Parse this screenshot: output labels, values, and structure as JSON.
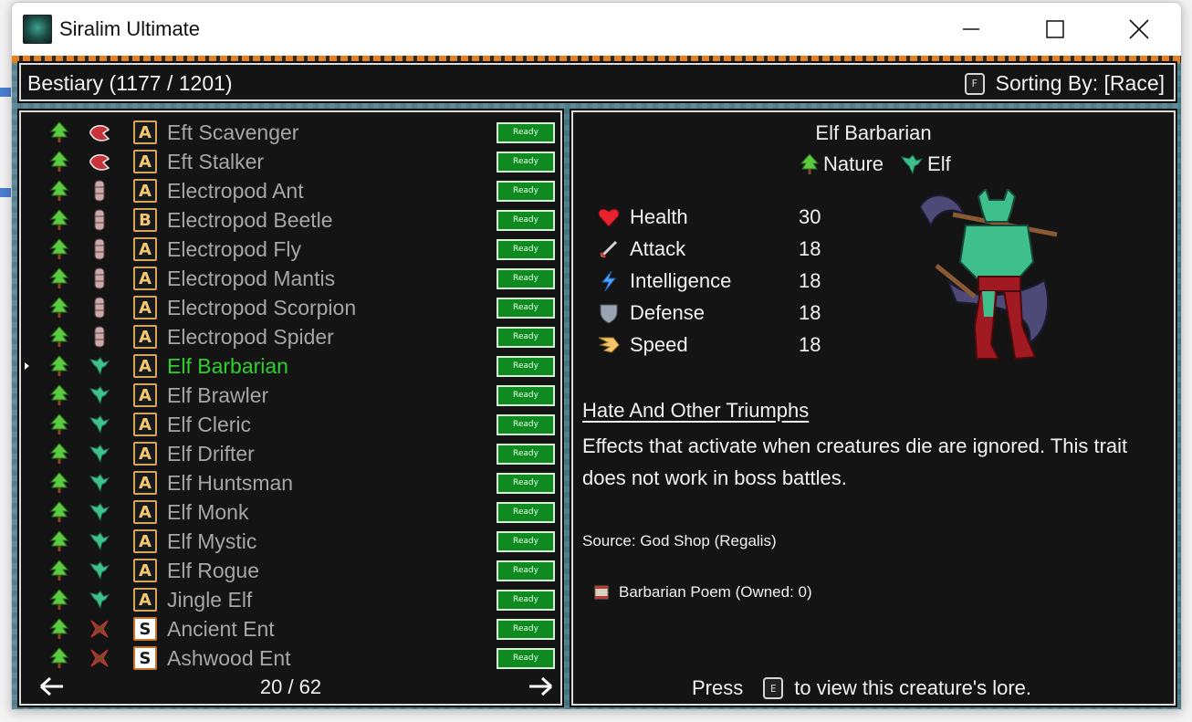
{
  "window": {
    "title": "Siralim Ultimate"
  },
  "header": {
    "title": "Bestiary (1177 / 1201)",
    "sort_key": "F",
    "sort_label": "Sorting By: [Race]"
  },
  "list": {
    "rows": [
      {
        "name": "Eft Scavenger",
        "race": "eft",
        "rarity": "A",
        "status": "Ready"
      },
      {
        "name": "Eft Stalker",
        "race": "eft",
        "rarity": "A",
        "status": "Ready"
      },
      {
        "name": "Electropod Ant",
        "race": "electropod",
        "rarity": "A",
        "status": "Ready"
      },
      {
        "name": "Electropod Beetle",
        "race": "electropod",
        "rarity": "B",
        "status": "Ready"
      },
      {
        "name": "Electropod Fly",
        "race": "electropod",
        "rarity": "A",
        "status": "Ready"
      },
      {
        "name": "Electropod Mantis",
        "race": "electropod",
        "rarity": "A",
        "status": "Ready"
      },
      {
        "name": "Electropod Scorpion",
        "race": "electropod",
        "rarity": "A",
        "status": "Ready"
      },
      {
        "name": "Electropod Spider",
        "race": "electropod",
        "rarity": "A",
        "status": "Ready"
      },
      {
        "name": "Elf Barbarian",
        "race": "elf",
        "rarity": "A",
        "status": "Ready",
        "selected": true
      },
      {
        "name": "Elf Brawler",
        "race": "elf",
        "rarity": "A",
        "status": "Ready"
      },
      {
        "name": "Elf Cleric",
        "race": "elf",
        "rarity": "A",
        "status": "Ready"
      },
      {
        "name": "Elf Drifter",
        "race": "elf",
        "rarity": "A",
        "status": "Ready"
      },
      {
        "name": "Elf Huntsman",
        "race": "elf",
        "rarity": "A",
        "status": "Ready"
      },
      {
        "name": "Elf Monk",
        "race": "elf",
        "rarity": "A",
        "status": "Ready"
      },
      {
        "name": "Elf Mystic",
        "race": "elf",
        "rarity": "A",
        "status": "Ready"
      },
      {
        "name": "Elf Rogue",
        "race": "elf",
        "rarity": "A",
        "status": "Ready"
      },
      {
        "name": "Jingle Elf",
        "race": "elf",
        "rarity": "A",
        "status": "Ready"
      },
      {
        "name": "Ancient Ent",
        "race": "ent",
        "rarity": "S",
        "status": "Ready"
      },
      {
        "name": "Ashwood Ent",
        "race": "ent",
        "rarity": "S",
        "status": "Ready"
      }
    ],
    "page": "20 / 62",
    "prev_icon": "left-arrow-icon",
    "next_icon": "right-arrow-icon"
  },
  "detail": {
    "name": "Elf Barbarian",
    "class_label": "Nature",
    "race_label": "Elf",
    "stats": [
      {
        "label": "Health",
        "value": "30",
        "icon": "heart-icon"
      },
      {
        "label": "Attack",
        "value": "18",
        "icon": "sword-icon"
      },
      {
        "label": "Intelligence",
        "value": "18",
        "icon": "lightning-icon"
      },
      {
        "label": "Defense",
        "value": "18",
        "icon": "shield-icon"
      },
      {
        "label": "Speed",
        "value": "18",
        "icon": "wing-icon"
      }
    ],
    "trait_name": "Hate And Other Triumphs",
    "trait_description": "Effects that activate when creatures die are ignored. This trait does not work in boss battles.",
    "source": "Source: God Shop (Regalis)",
    "item": "Barbarian Poem (Owned: 0)",
    "lore_prefix": "Press",
    "lore_key": "E",
    "lore_suffix": "to view this creature's lore."
  },
  "colors": {
    "selected_name": "#2fd12f",
    "ready_bg": "#0e8a20",
    "panel_bg": "#141414"
  }
}
